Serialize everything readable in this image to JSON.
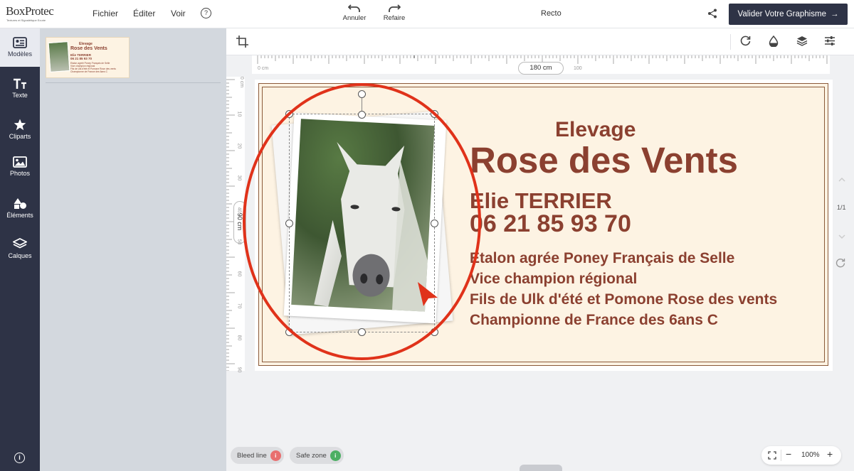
{
  "header": {
    "logo_text": "BoxProtec",
    "logo_tagline": "Textures et Signalétique Ecurie",
    "menu": [
      "Fichier",
      "Éditer",
      "Voir"
    ],
    "help_label": "?",
    "undo_label": "Annuler",
    "redo_label": "Refaire",
    "side_label": "Recto",
    "validate_label": "Valider Votre Graphisme",
    "validate_arrow": "→"
  },
  "sidebar": {
    "items": [
      {
        "label": "Modèles",
        "icon": "template-icon"
      },
      {
        "label": "Texte",
        "icon": "text-icon"
      },
      {
        "label": "Cliparts",
        "icon": "star-icon"
      },
      {
        "label": "Photos",
        "icon": "image-icon"
      },
      {
        "label": "Éléments",
        "icon": "shapes-icon"
      },
      {
        "label": "Calques",
        "icon": "layers-icon"
      }
    ],
    "info_label": "i"
  },
  "template_thumb": {
    "line1": "Elevage",
    "line2": "Rose des Vents",
    "line3": "Elie TERRIER",
    "line4": "06 21 85 93 70",
    "line5": "Etalon agréé Poney Français de Selle",
    "line6": "Vice champion régional",
    "line7": "Fils de Ulk d'été et Pomone Rose des vents",
    "line8": "Championne de France des 6ans C"
  },
  "rulers": {
    "width_label": "180 cm",
    "height_label": "90 cm",
    "h_ticks": [
      "0 cm",
      "100"
    ],
    "v_ticks": [
      "0 cm",
      "10",
      "20",
      "30",
      "40",
      "50",
      "60",
      "70",
      "80",
      "90"
    ]
  },
  "card": {
    "title_small": "Elevage",
    "title_large": "Rose des Vents",
    "name": "Elie TERRIER",
    "phone": "06 21 85 93 70",
    "lines": [
      "Etalon agrée Poney Français de Selle",
      "Vice champion régional",
      "Fils de Ulk d'été et Pomone Rose des vents",
      "Championne de France des 6ans C"
    ],
    "text_color": "#8b4030",
    "bg_color": "#fdf3e3"
  },
  "right_rail": {
    "page_indicator": "1/1"
  },
  "footer": {
    "bleed_label": "Bleed line",
    "safe_label": "Safe zone",
    "zoom_value": "100%",
    "zoom_minus": "−",
    "zoom_plus": "+"
  },
  "colors": {
    "sidebar": "#2e3346",
    "accent_red": "#e0321a",
    "bleed": "#e86f6f",
    "safe": "#4caf63"
  }
}
